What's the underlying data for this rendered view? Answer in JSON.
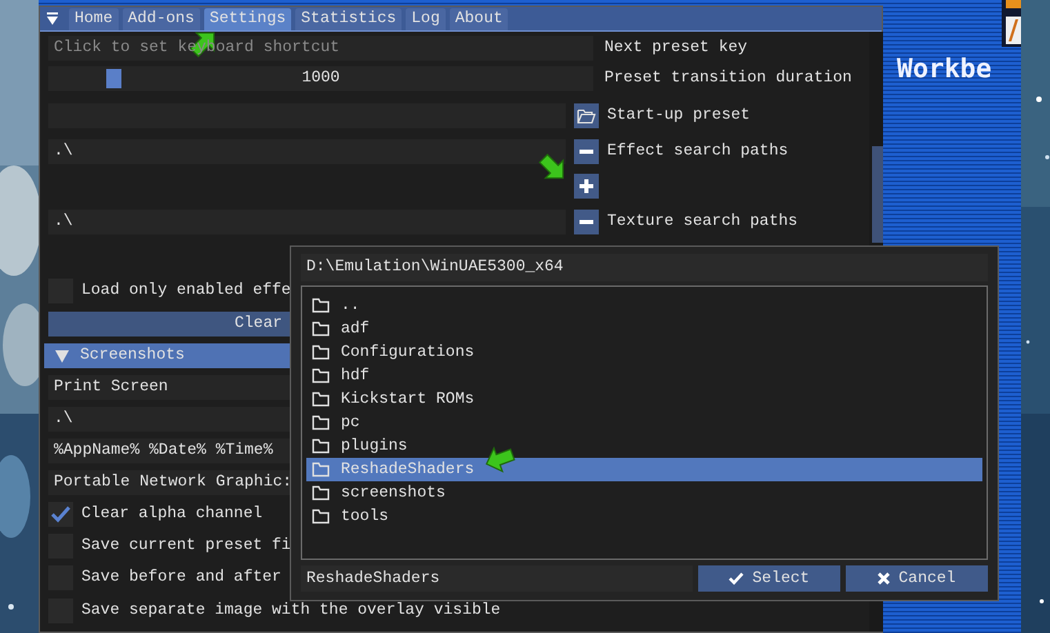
{
  "tabs": [
    {
      "label": "Home",
      "selected": false
    },
    {
      "label": "Add-ons",
      "selected": false
    },
    {
      "label": "Settings",
      "selected": true
    },
    {
      "label": "Statistics",
      "selected": false
    },
    {
      "label": "Log",
      "selected": false
    },
    {
      "label": "About",
      "selected": false
    }
  ],
  "general": {
    "next_preset_key": {
      "placeholder": "Click to set keyboard shortcut",
      "label": "Next preset key"
    },
    "transition": {
      "value": "1000",
      "level": 0.11,
      "label": "Preset transition duration"
    },
    "startup_preset": {
      "label": "Start-up preset"
    },
    "effect_paths": {
      "items": [
        ".\\"
      ],
      "label": "Effect search paths"
    },
    "texture_paths": {
      "items": [
        ".\\"
      ],
      "label": "Texture search paths"
    },
    "load_only_enabled": {
      "label": "Load only enabled effe",
      "checked": false
    },
    "clear_button": "Clear"
  },
  "screenshots": {
    "title": "Screenshots",
    "expanded": true,
    "fields": [
      "Print Screen",
      ".\\",
      "%AppName% %Date% %Time%",
      "Portable Network Graphic:"
    ],
    "options": [
      {
        "label": "Clear alpha channel",
        "checked": true
      },
      {
        "label": "Save current preset fi",
        "checked": false
      },
      {
        "label": "Save before and after",
        "checked": false
      },
      {
        "label": "Save separate image with the overlay visible",
        "checked": false
      }
    ]
  },
  "dialog": {
    "path": "D:\\Emulation\\WinUAE5300_x64",
    "entries": [
      {
        "name": "..",
        "selected": false
      },
      {
        "name": "adf",
        "selected": false
      },
      {
        "name": "Configurations",
        "selected": false
      },
      {
        "name": "hdf",
        "selected": false
      },
      {
        "name": "Kickstart ROMs",
        "selected": false
      },
      {
        "name": "pc",
        "selected": false
      },
      {
        "name": "plugins",
        "selected": false
      },
      {
        "name": "ReshadeShaders",
        "selected": true
      },
      {
        "name": "screenshots",
        "selected": false
      },
      {
        "name": "tools",
        "selected": false
      }
    ],
    "filename": "ReshadeShaders",
    "buttons": [
      {
        "kind": "select",
        "label": "Select"
      },
      {
        "kind": "cancel",
        "label": "Cancel"
      }
    ]
  },
  "desktop": {
    "title": "Workbe"
  }
}
